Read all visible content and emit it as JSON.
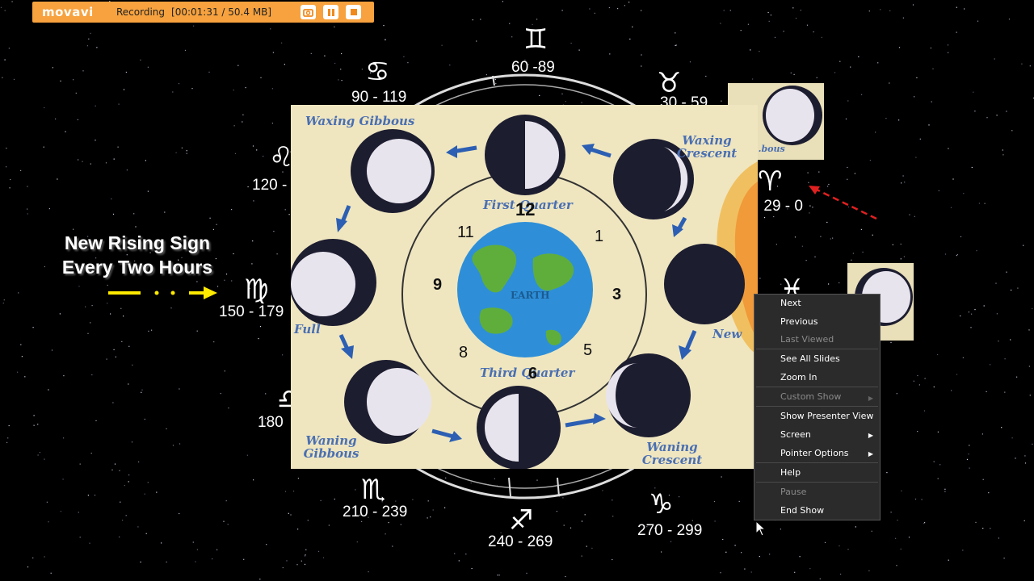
{
  "recorder": {
    "brand": "movavi",
    "status": "Recording",
    "time_size": "[00:01:31 / 50.4 MB]",
    "bg_color": "#f7a23e",
    "buttons": [
      "camera-icon",
      "pause-icon",
      "stop-icon"
    ]
  },
  "rising_sign": {
    "line1": "New Rising Sign",
    "line2": "Every Two Hours"
  },
  "zodiac": {
    "gemini": {
      "symbol": "♊",
      "range": "60 -89"
    },
    "cancer": {
      "symbol": "♋",
      "range": "90 - 119"
    },
    "taurus": {
      "symbol": "♉",
      "range": "30 - 59"
    },
    "leo": {
      "symbol": "♌",
      "range": "120 -"
    },
    "aries": {
      "symbol": "♈",
      "range": "0 - 29"
    },
    "virgo": {
      "symbol": "♍",
      "range": "150 - 179"
    },
    "pisces": {
      "symbol": "♓"
    },
    "libra": {
      "symbol": "♎",
      "range": "180"
    },
    "scorpio": {
      "symbol": "♏",
      "range": "210 - 239"
    },
    "sagittarius": {
      "symbol": "♐",
      "range": "240 - 269"
    },
    "capricorn": {
      "symbol": "♑",
      "range": "270 - 299"
    }
  },
  "photo": {
    "waxing_gibbous": "Waxing Gibbous",
    "first_quarter": "First Quarter",
    "waxing_crescent": "Waxing Crescent",
    "full": "Full",
    "new": "New",
    "waning_gibbous": "Waning Gibbous",
    "third_quarter": "Third Quarter",
    "waning_crescent": "Waning Crescent",
    "earth": "EARTH",
    "thumb_label": "...bous",
    "clock": {
      "n12": "12",
      "n1": "1",
      "n3": "3",
      "n5": "5",
      "n6": "6",
      "n8": "8",
      "n9": "9",
      "n11": "11"
    }
  },
  "context_menu": {
    "items": [
      {
        "label": "Next",
        "enabled": true
      },
      {
        "label": "Previous",
        "enabled": true
      },
      {
        "label": "Last Viewed",
        "enabled": false
      },
      {
        "label": "See All Slides",
        "enabled": true
      },
      {
        "label": "Zoom In",
        "enabled": true
      },
      {
        "label": "Custom Show",
        "enabled": false,
        "submenu": true
      },
      {
        "label": "Show Presenter View",
        "enabled": true
      },
      {
        "label": "Screen",
        "enabled": true,
        "submenu": true
      },
      {
        "label": "Pointer Options",
        "enabled": true,
        "submenu": true
      },
      {
        "label": "Help",
        "enabled": true
      },
      {
        "label": "Pause",
        "enabled": false
      },
      {
        "label": "End Show",
        "enabled": true
      }
    ]
  },
  "colors": {
    "background": "#000000",
    "menu_bg": "#2b2b2b",
    "photo_text": "#4a6fb2",
    "yellow_arrow": "#ffea00",
    "red_arrow": "#e02020"
  }
}
